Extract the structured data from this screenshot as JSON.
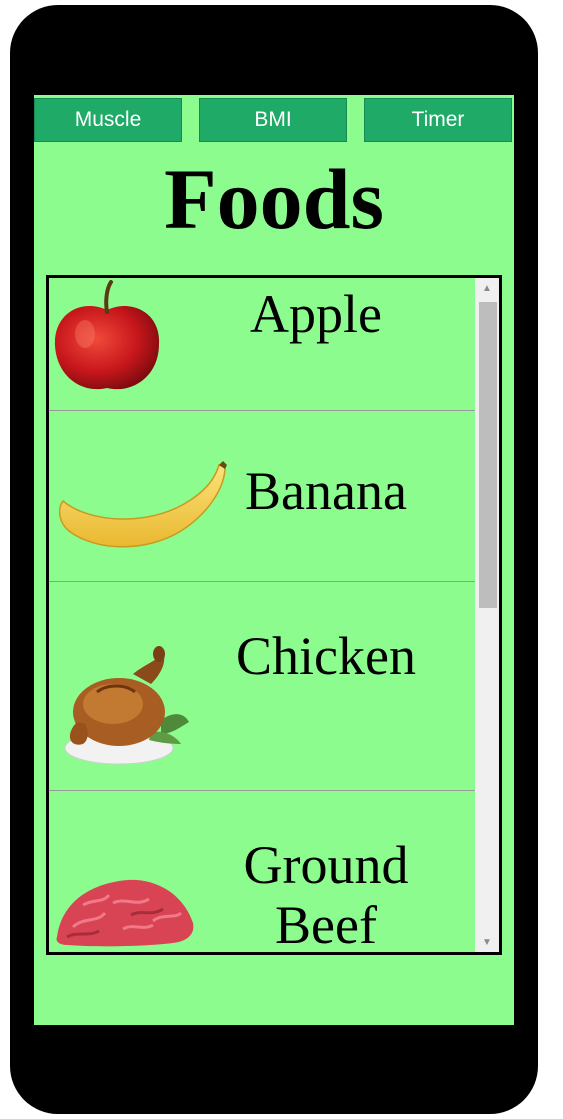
{
  "nav": {
    "muscle_label": "Muscle",
    "bmi_label": "BMI",
    "timer_label": "Timer"
  },
  "page": {
    "title": "Foods"
  },
  "foods": [
    {
      "name": "Apple",
      "icon": "apple-icon"
    },
    {
      "name": "Banana",
      "icon": "banana-icon"
    },
    {
      "name": "Chicken",
      "icon": "roast-chicken-icon"
    },
    {
      "name": "Ground Beef",
      "icon": "ground-beef-icon"
    }
  ],
  "colors": {
    "phone_frame": "#000000",
    "screen_bg": "#8dfc8f",
    "nav_button_bg": "#1faa67",
    "nav_button_text": "#ffffff",
    "scrollbar_track": "#f0f0f0",
    "scrollbar_thumb": "#bdbdbd"
  }
}
